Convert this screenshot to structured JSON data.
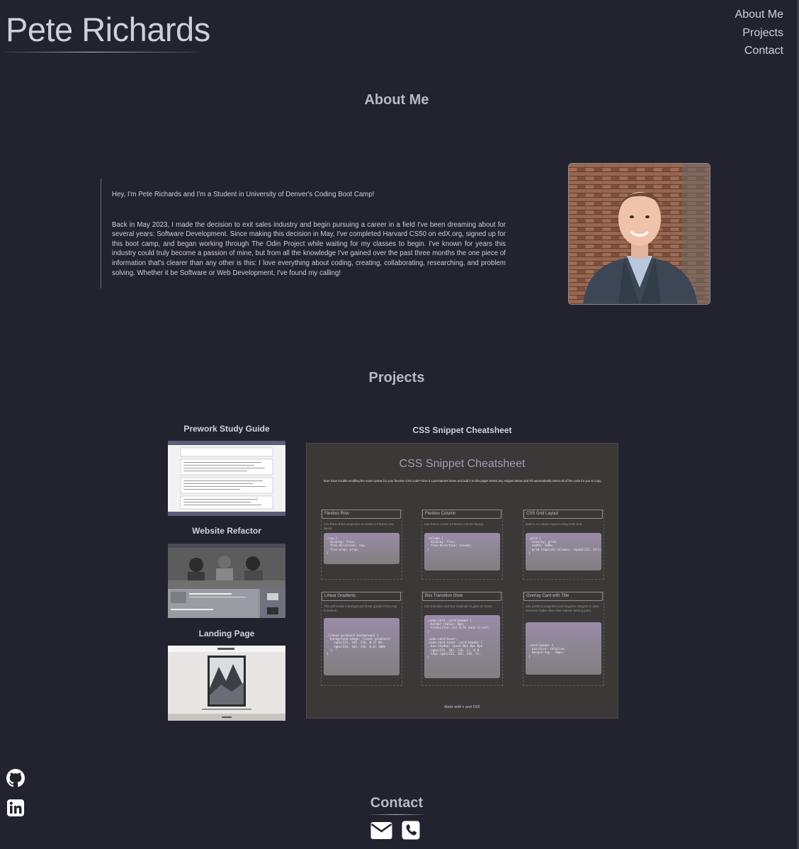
{
  "header": {
    "site_title": "Pete Richards",
    "nav": [
      "About Me",
      "Projects",
      "Contact"
    ]
  },
  "about": {
    "heading": "About Me",
    "greeting": "Hey, I'm Pete Richards and I'm a Student in University of Denver's Coding Boot Camp!",
    "bio": "Back in May 2023, I made the decision to exit sales industry and begin pursuing a career in a field I've been dreaming about for several years: Software Development. Since making this decision in May, I've completed Harvard CS50 on edX.org, signed up for this boot camp, and began working through The Odin Project while waiting for my classes to begin. I've known for years this industry could truly become a passion of mine, but from all the knowledge I've gained over the past three months the one piece of information that's clearer than any other is this: I love everything about coding, creating, collaborating, researching, and problem solving. Whether it be Software or Web Development, I've found my calling!"
  },
  "projects": {
    "heading": "Projects",
    "items": [
      {
        "label": "Prework Study Guide"
      },
      {
        "label": "Website Refactor"
      },
      {
        "label": "Landing Page"
      },
      {
        "label": "CSS Snippet Cheatsheet"
      }
    ],
    "cheatsheet_preview": {
      "title": "CSS Snippet Cheatsheet",
      "intro": "Ever have trouble recalling the exact syntax for your favorite CSS code? Give it a permanent home and add it to this page! Select any snippet below and it'll automatically select all of the code for you to copy.",
      "cards": [
        {
          "title": "Flexbox Row",
          "desc": "Use these three properties to create a Flexbox row layout.",
          "code": ".row {\n  display: flex;\n  flex-direction: row;\n  flex-wrap: wrap;\n}"
        },
        {
          "title": "Flexbox Column",
          "desc": "Use this to create a Flexbox column layout.",
          "code": ".column {\n  display: flex;\n  flex-direction: column;\n}"
        },
        {
          "title": "CSS Grid Layout",
          "desc": "Build a 12 column layout using CSS Grid.",
          "code": ".grid {\n  display: grid;\n  width: 100%;\n  grid-template-columns: repeat(12, 1fr);\n}"
        },
        {
          "title": "Linear Gradients",
          "desc": "This will create a background linear gradient from top to bottom.",
          "code": ".linear-gradient-background {\n  background-image: linear-gradient(\n    rgba(232, 102, 236, 0.3) 0%,\n    rgba(232, 102, 236, 0.6) 100%\n  );\n}"
        },
        {
          "title": "Box Transition Glow",
          "desc": "Use transition and box shadows to glow on hover.",
          "code": ".code-card .card-header {\n  border-radius: 8px;\n  transition: all 0.5s ease-in-out;\n}\n\n.code-card:hover,\n.code-card:hover .card-header {\n  box-shadow: inset 0px 0px 8px\n  rgba(232, 102, 236, 1), 0 0\n  15px rgba(232, 102, 236, 1);\n}"
        },
        {
          "title": "Overlay Card with Title",
          "desc": "Use position properties and negative margins to raise elements higher than their natural starting point.",
          "code": ".card-header {\n  position: relative;\n  margin-top: -20px;\n}"
        }
      ],
      "footer": "Made with ♥ and CSS"
    }
  },
  "contact": {
    "heading": "Contact"
  },
  "icons": {
    "github": "github-icon",
    "linkedin": "linkedin-icon",
    "email": "envelope-icon",
    "phone": "phone-icon"
  },
  "colors": {
    "background": "#23222f",
    "heading": "#b9b8c2",
    "text": "#cfced8",
    "accent": "#a49bb2"
  }
}
